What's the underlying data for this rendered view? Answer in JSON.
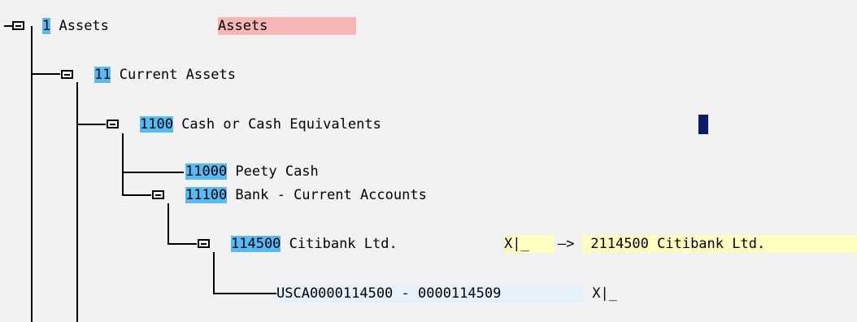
{
  "nodes": [
    {
      "code": "1",
      "label": " Assets"
    },
    {
      "code": "11",
      "label": " Current Assets"
    },
    {
      "code": "1100",
      "label": " Cash or Cash Equivalents"
    },
    {
      "code": "11000",
      "label": " Peety Cash"
    },
    {
      "code": "11100",
      "label": " Bank - Current Accounts"
    },
    {
      "code": "114500",
      "label": " Citibank Ltd."
    },
    {
      "code": "USCA0000114500 - 0000114509",
      "label": " X|_"
    }
  ],
  "assets_field": "Assets",
  "citibank_field": "X|_",
  "citibank_mapping": "2114500 Citibank Ltd.",
  "arrow": "—>"
}
